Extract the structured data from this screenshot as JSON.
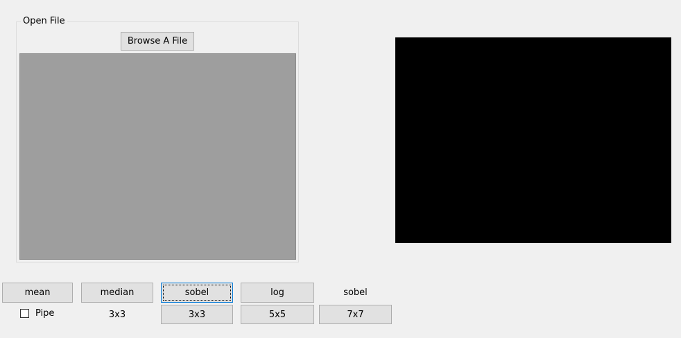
{
  "open_file": {
    "group_title": "Open File",
    "browse_label": "Browse A File"
  },
  "filters": {
    "mean_label": "mean",
    "median_label": "median",
    "sobel_label": "sobel",
    "log_label": "log",
    "sobel_caption": "sobel"
  },
  "options": {
    "pipe_label": "Pipe",
    "pipe_checked": false,
    "size_3x3_label": "3x3",
    "btn_3x3_label": "3x3",
    "btn_5x5_label": "5x5",
    "btn_7x7_label": "7x7"
  }
}
